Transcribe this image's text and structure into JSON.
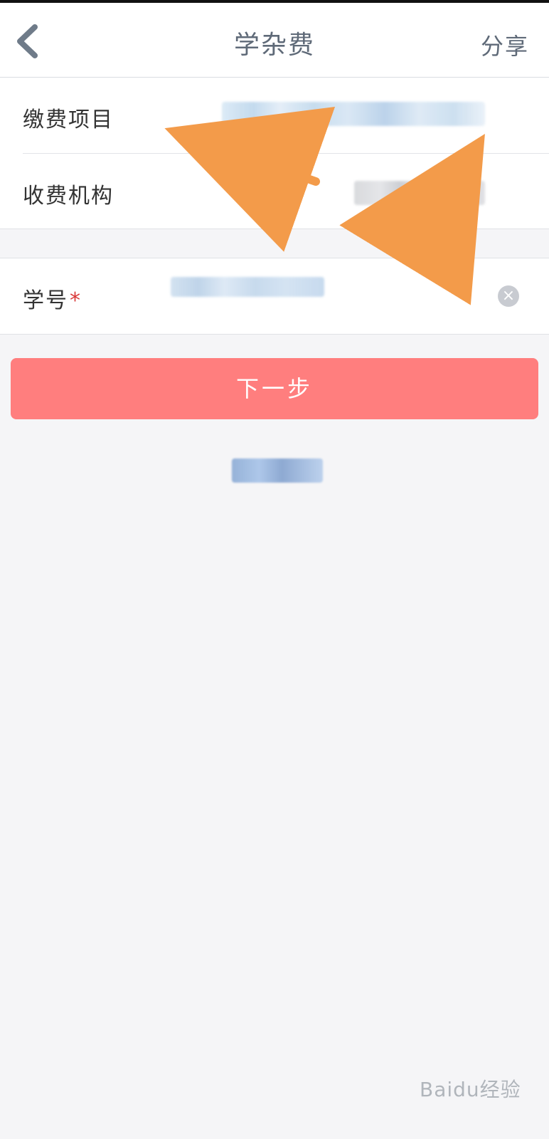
{
  "nav": {
    "title": "学杂费",
    "share_label": "分享",
    "back_icon": "chevron-left-icon"
  },
  "form": {
    "payment_item": {
      "label": "缴费项目",
      "value": ""
    },
    "charging_org": {
      "label": "收费机构",
      "value": ""
    },
    "student_id": {
      "label": "学号",
      "required_mark": "*",
      "value": "",
      "clear_icon": "clear-icon"
    }
  },
  "actions": {
    "next_label": "下一步",
    "footer_link": ""
  },
  "colors": {
    "accent_button": "#ff7e7e",
    "annotation_arrow": "#f39b4a",
    "required_mark": "#d93a3a"
  },
  "watermark": {
    "text": "Baidu经验"
  }
}
